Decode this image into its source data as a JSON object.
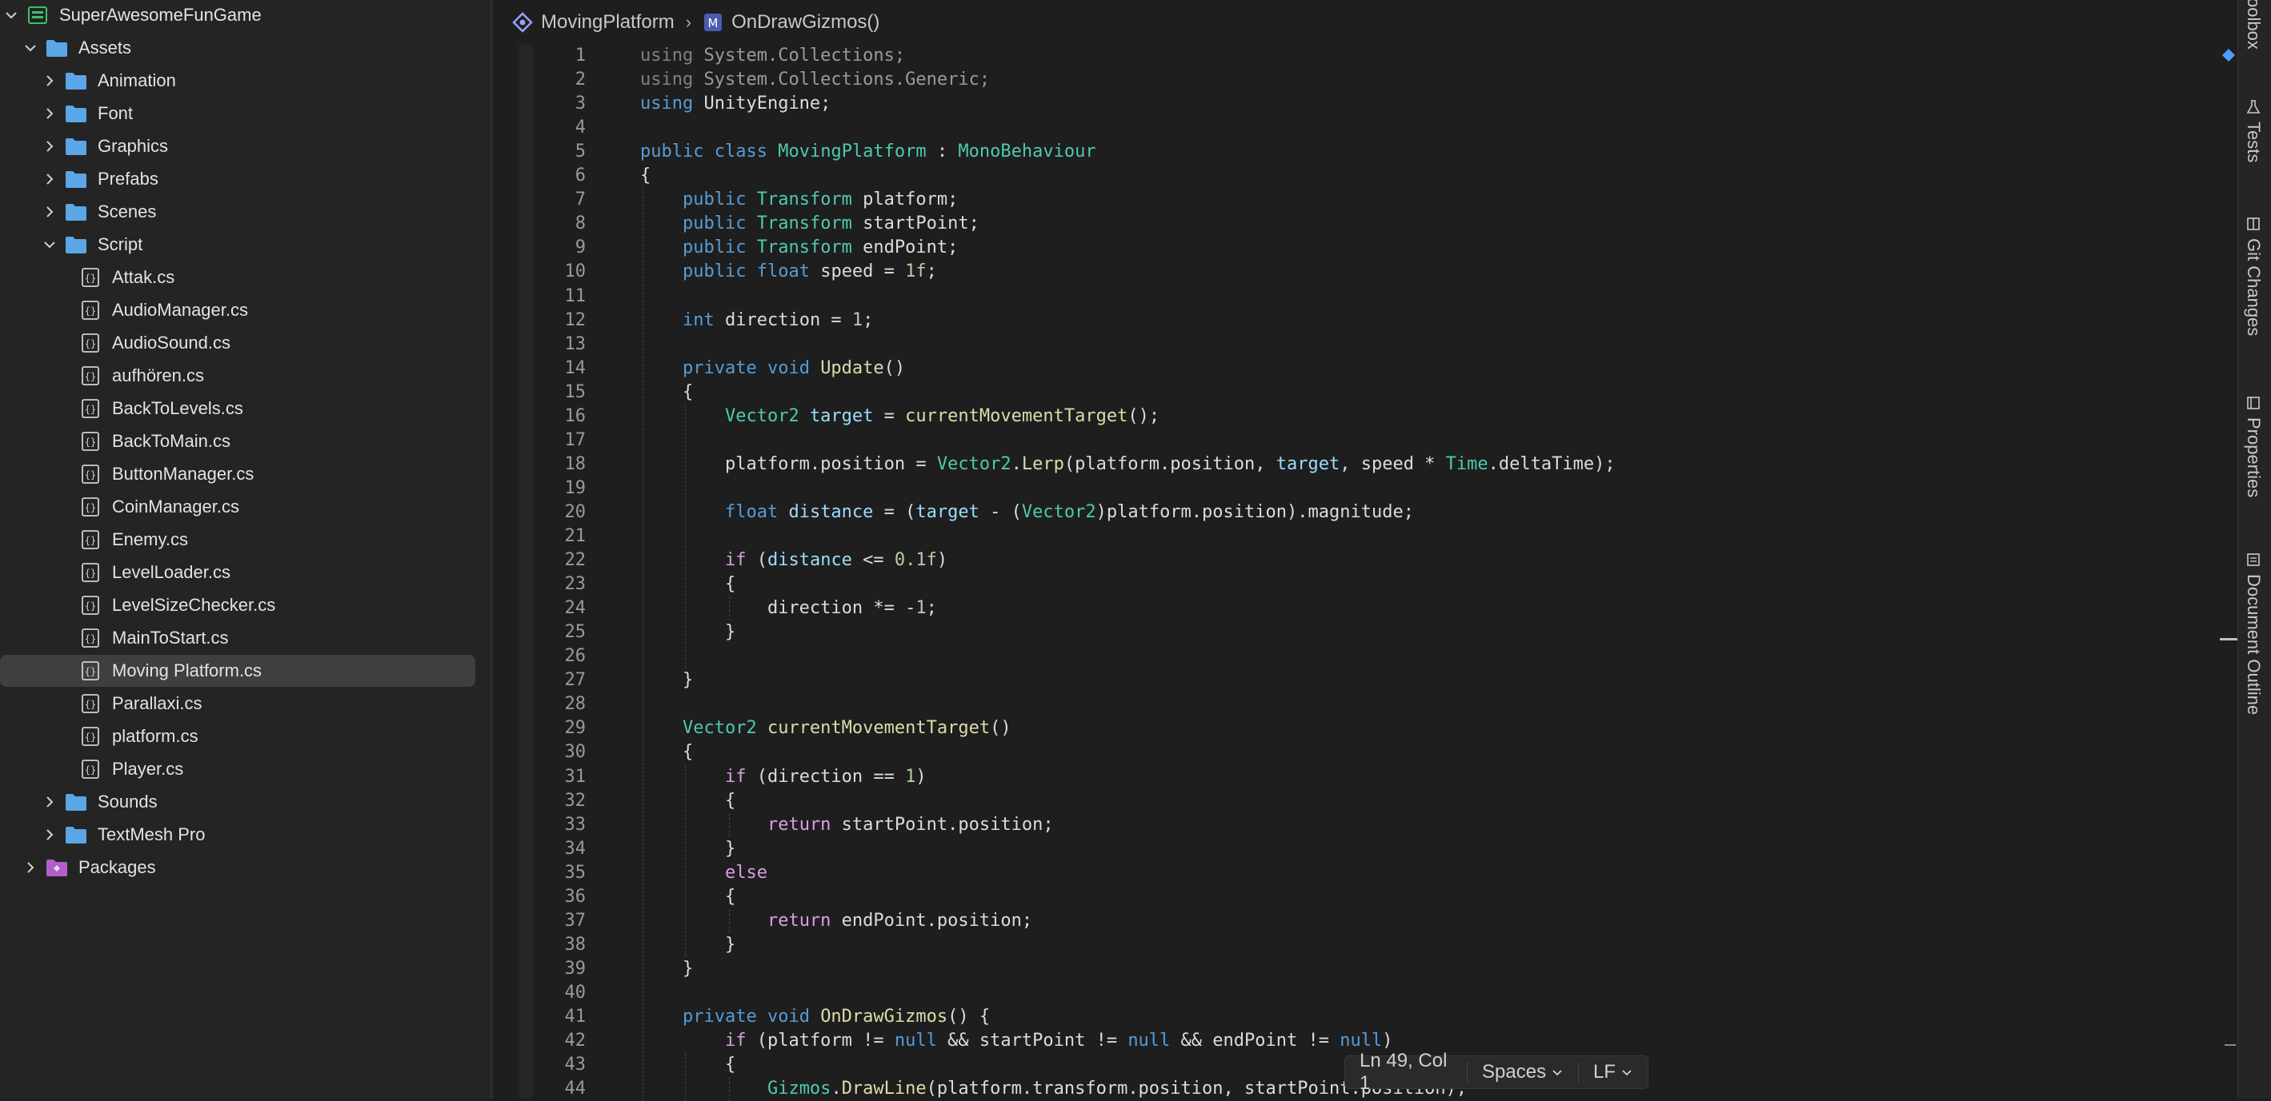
{
  "explorer": {
    "root": "SuperAwesomeFunGame",
    "assets": "Assets",
    "folders_top": [
      "Animation",
      "Font",
      "Graphics",
      "Prefabs",
      "Scenes"
    ],
    "script_folder": "Script",
    "scripts": [
      "Attak.cs",
      "AudioManager.cs",
      "AudioSound.cs",
      "aufhören.cs",
      "BackToLevels.cs",
      "BackToMain.cs",
      "ButtonManager.cs",
      "CoinManager.cs",
      "Enemy.cs",
      "LevelLoader.cs",
      "LevelSizeChecker.cs",
      "MainToStart.cs",
      "Moving Platform.cs",
      "Parallaxi.cs",
      "platform.cs",
      "Player.cs"
    ],
    "selected_script": "Moving Platform.cs",
    "folders_bottom": [
      "Sounds",
      "TextMesh Pro"
    ],
    "packages": "Packages"
  },
  "breadcrumb": {
    "class_name": "MovingPlatform",
    "separator": "›",
    "method_badge": "M",
    "method_name": "OnDrawGizmos()"
  },
  "code": {
    "line_numbers": [
      "1",
      "2",
      "3",
      "4",
      "5",
      "6",
      "7",
      "8",
      "9",
      "10",
      "11",
      "12",
      "13",
      "14",
      "15",
      "16",
      "17",
      "18",
      "19",
      "20",
      "21",
      "22",
      "23",
      "24",
      "25",
      "26",
      "27",
      "28",
      "29",
      "30",
      "31",
      "32",
      "33",
      "34",
      "35",
      "36",
      "37",
      "38",
      "39",
      "40",
      "41",
      "42",
      "43",
      "44"
    ],
    "lines": [
      [
        [
          "using",
          "t-fade"
        ],
        [
          " System.Collections;",
          "t-ns"
        ]
      ],
      [
        [
          "using",
          "t-fade"
        ],
        [
          " System.Collections.Generic;",
          "t-ns"
        ]
      ],
      [
        [
          "using",
          "t-kw"
        ],
        [
          " UnityEngine;",
          ""
        ]
      ],
      [],
      [
        [
          "public",
          "t-kw"
        ],
        [
          " ",
          ""
        ],
        [
          "class",
          "t-kw"
        ],
        [
          " ",
          ""
        ],
        [
          "MovingPlatform",
          "t-type"
        ],
        [
          " : ",
          ""
        ],
        [
          "MonoBehaviour",
          "t-type"
        ]
      ],
      [
        [
          "{",
          ""
        ]
      ],
      [
        [
          "    ",
          ""
        ],
        [
          "public",
          "t-kw"
        ],
        [
          " ",
          ""
        ],
        [
          "Transform",
          "t-type"
        ],
        [
          " platform;",
          ""
        ]
      ],
      [
        [
          "    ",
          ""
        ],
        [
          "public",
          "t-kw"
        ],
        [
          " ",
          ""
        ],
        [
          "Transform",
          "t-type"
        ],
        [
          " startPoint;",
          ""
        ]
      ],
      [
        [
          "    ",
          ""
        ],
        [
          "public",
          "t-kw"
        ],
        [
          " ",
          ""
        ],
        [
          "Transform",
          "t-type"
        ],
        [
          " endPoint;",
          ""
        ]
      ],
      [
        [
          "    ",
          ""
        ],
        [
          "public",
          "t-kw"
        ],
        [
          " ",
          ""
        ],
        [
          "float",
          "t-kw"
        ],
        [
          " speed = ",
          ""
        ],
        [
          "1f",
          "t-num"
        ],
        [
          ";",
          ""
        ]
      ],
      [],
      [
        [
          "    ",
          ""
        ],
        [
          "int",
          "t-kw"
        ],
        [
          " direction = ",
          ""
        ],
        [
          "1",
          "t-num"
        ],
        [
          ";",
          ""
        ]
      ],
      [],
      [
        [
          "    ",
          ""
        ],
        [
          "private",
          "t-kw"
        ],
        [
          " ",
          ""
        ],
        [
          "void",
          "t-kw"
        ],
        [
          " ",
          ""
        ],
        [
          "Update",
          "t-fn"
        ],
        [
          "()",
          ""
        ]
      ],
      [
        [
          "    {",
          ""
        ]
      ],
      [
        [
          "        ",
          ""
        ],
        [
          "Vector2",
          "t-type"
        ],
        [
          " ",
          ""
        ],
        [
          "target",
          "t-var"
        ],
        [
          " = ",
          ""
        ],
        [
          "currentMovementTarget",
          "t-fn"
        ],
        [
          "();",
          ""
        ]
      ],
      [],
      [
        [
          "        platform.position = ",
          ""
        ],
        [
          "Vector2",
          "t-type"
        ],
        [
          ".",
          ""
        ],
        [
          "Lerp",
          "t-fn"
        ],
        [
          "(platform.position, ",
          ""
        ],
        [
          "target",
          "t-var"
        ],
        [
          ", speed * ",
          ""
        ],
        [
          "Time",
          "t-type"
        ],
        [
          ".deltaTime);",
          ""
        ]
      ],
      [],
      [
        [
          "        ",
          ""
        ],
        [
          "float",
          "t-kw"
        ],
        [
          " ",
          ""
        ],
        [
          "distance",
          "t-var"
        ],
        [
          " = (",
          ""
        ],
        [
          "target",
          "t-var"
        ],
        [
          " - (",
          ""
        ],
        [
          "Vector2",
          "t-type"
        ],
        [
          ")platform.position).magnitude;",
          ""
        ]
      ],
      [],
      [
        [
          "        ",
          ""
        ],
        [
          "if",
          "t-ctrl"
        ],
        [
          " (",
          ""
        ],
        [
          "distance",
          "t-var"
        ],
        [
          " <= ",
          ""
        ],
        [
          "0.1f",
          "t-num"
        ],
        [
          ")",
          ""
        ]
      ],
      [
        [
          "        {",
          ""
        ]
      ],
      [
        [
          "            direction *= -",
          ""
        ],
        [
          "1",
          "t-num"
        ],
        [
          ";",
          ""
        ]
      ],
      [
        [
          "        }",
          ""
        ]
      ],
      [],
      [
        [
          "    }",
          ""
        ]
      ],
      [],
      [
        [
          "    ",
          ""
        ],
        [
          "Vector2",
          "t-type"
        ],
        [
          " ",
          ""
        ],
        [
          "currentMovementTarget",
          "t-fn"
        ],
        [
          "()",
          ""
        ]
      ],
      [
        [
          "    {",
          ""
        ]
      ],
      [
        [
          "        ",
          ""
        ],
        [
          "if",
          "t-ctrl"
        ],
        [
          " (direction == ",
          ""
        ],
        [
          "1",
          "t-num"
        ],
        [
          ")",
          ""
        ]
      ],
      [
        [
          "        {",
          ""
        ]
      ],
      [
        [
          "            ",
          ""
        ],
        [
          "return",
          "t-ctrl"
        ],
        [
          " startPoint.position;",
          ""
        ]
      ],
      [
        [
          "        }",
          ""
        ]
      ],
      [
        [
          "        ",
          ""
        ],
        [
          "else",
          "t-ctrl"
        ]
      ],
      [
        [
          "        {",
          ""
        ]
      ],
      [
        [
          "            ",
          ""
        ],
        [
          "return",
          "t-ctrl"
        ],
        [
          " endPoint.position;",
          ""
        ]
      ],
      [
        [
          "        }",
          ""
        ]
      ],
      [
        [
          "    }",
          ""
        ]
      ],
      [],
      [
        [
          "    ",
          ""
        ],
        [
          "private",
          "t-kw"
        ],
        [
          " ",
          ""
        ],
        [
          "void",
          "t-kw"
        ],
        [
          " ",
          ""
        ],
        [
          "OnDrawGizmos",
          "t-fn"
        ],
        [
          "() {",
          ""
        ]
      ],
      [
        [
          "        ",
          ""
        ],
        [
          "if",
          "t-ctrl"
        ],
        [
          " (platform != ",
          ""
        ],
        [
          "null",
          "t-kw"
        ],
        [
          " && startPoint != ",
          ""
        ],
        [
          "null",
          "t-kw"
        ],
        [
          " && endPoint != ",
          ""
        ],
        [
          "null",
          "t-kw"
        ],
        [
          ")",
          ""
        ]
      ],
      [
        [
          "        {",
          ""
        ]
      ],
      [
        [
          "            ",
          ""
        ],
        [
          "Gizmos",
          "t-type"
        ],
        [
          ".",
          ""
        ],
        [
          "DrawLine",
          "t-fn"
        ],
        [
          "(platform.transform.position, startPoint.position);",
          ""
        ]
      ]
    ]
  },
  "status": {
    "position": "Ln 49, Col 1",
    "indent": "Spaces",
    "line_ending": "LF"
  },
  "right_tabs": [
    "Toolbox",
    "Tests",
    "Git Changes",
    "Properties",
    "Document Outline"
  ],
  "colors": {
    "keyword": "#569cd6",
    "control": "#d8a0df",
    "type": "#4ec9b0",
    "method": "#dcdcaa",
    "local": "#9cdcfe",
    "number": "#b5cea8",
    "folder": "#5aa6e6"
  }
}
